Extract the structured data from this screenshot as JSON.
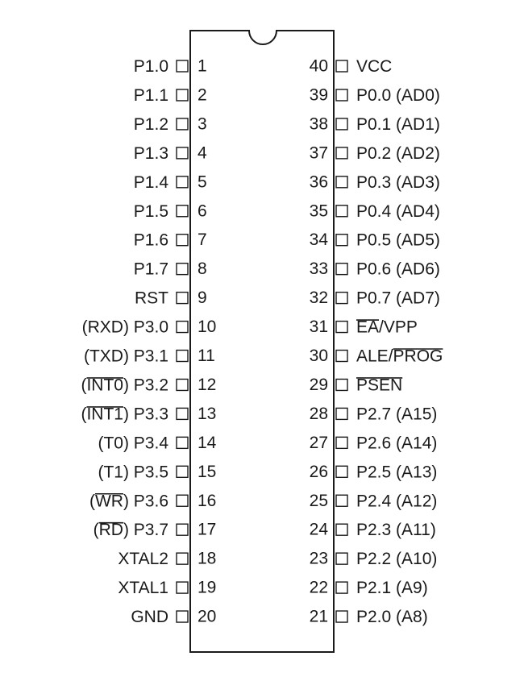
{
  "left_pins": [
    {
      "num": "1",
      "segments": [
        {
          "t": "P1.0",
          "o": false
        }
      ]
    },
    {
      "num": "2",
      "segments": [
        {
          "t": "P1.1",
          "o": false
        }
      ]
    },
    {
      "num": "3",
      "segments": [
        {
          "t": "P1.2",
          "o": false
        }
      ]
    },
    {
      "num": "4",
      "segments": [
        {
          "t": "P1.3",
          "o": false
        }
      ]
    },
    {
      "num": "5",
      "segments": [
        {
          "t": "P1.4",
          "o": false
        }
      ]
    },
    {
      "num": "6",
      "segments": [
        {
          "t": "P1.5",
          "o": false
        }
      ]
    },
    {
      "num": "7",
      "segments": [
        {
          "t": "P1.6",
          "o": false
        }
      ]
    },
    {
      "num": "8",
      "segments": [
        {
          "t": "P1.7",
          "o": false
        }
      ]
    },
    {
      "num": "9",
      "segments": [
        {
          "t": "RST",
          "o": false
        }
      ]
    },
    {
      "num": "10",
      "segments": [
        {
          "t": "(RXD) P3.0",
          "o": false
        }
      ]
    },
    {
      "num": "11",
      "segments": [
        {
          "t": "(TXD) P3.1",
          "o": false
        }
      ]
    },
    {
      "num": "12",
      "segments": [
        {
          "t": "(",
          "o": false
        },
        {
          "t": "INT0",
          "o": true
        },
        {
          "t": ") P3.2",
          "o": false
        }
      ]
    },
    {
      "num": "13",
      "segments": [
        {
          "t": "(",
          "o": false
        },
        {
          "t": "INT1",
          "o": true
        },
        {
          "t": ") P3.3",
          "o": false
        }
      ]
    },
    {
      "num": "14",
      "segments": [
        {
          "t": "(T0) P3.4",
          "o": false
        }
      ]
    },
    {
      "num": "15",
      "segments": [
        {
          "t": "(T1) P3.5",
          "o": false
        }
      ]
    },
    {
      "num": "16",
      "segments": [
        {
          "t": "(",
          "o": false
        },
        {
          "t": "WR",
          "o": true
        },
        {
          "t": ") P3.6",
          "o": false
        }
      ]
    },
    {
      "num": "17",
      "segments": [
        {
          "t": "(",
          "o": false
        },
        {
          "t": "RD",
          "o": true
        },
        {
          "t": ") P3.7",
          "o": false
        }
      ]
    },
    {
      "num": "18",
      "segments": [
        {
          "t": "XTAL2",
          "o": false
        }
      ]
    },
    {
      "num": "19",
      "segments": [
        {
          "t": "XTAL1",
          "o": false
        }
      ]
    },
    {
      "num": "20",
      "segments": [
        {
          "t": "GND",
          "o": false
        }
      ]
    }
  ],
  "right_pins": [
    {
      "num": "40",
      "segments": [
        {
          "t": "VCC",
          "o": false
        }
      ]
    },
    {
      "num": "39",
      "segments": [
        {
          "t": "P0.0 (AD0)",
          "o": false
        }
      ]
    },
    {
      "num": "38",
      "segments": [
        {
          "t": "P0.1 (AD1)",
          "o": false
        }
      ]
    },
    {
      "num": "37",
      "segments": [
        {
          "t": "P0.2 (AD2)",
          "o": false
        }
      ]
    },
    {
      "num": "36",
      "segments": [
        {
          "t": "P0.3 (AD3)",
          "o": false
        }
      ]
    },
    {
      "num": "35",
      "segments": [
        {
          "t": "P0.4 (AD4)",
          "o": false
        }
      ]
    },
    {
      "num": "34",
      "segments": [
        {
          "t": "P0.5 (AD5)",
          "o": false
        }
      ]
    },
    {
      "num": "33",
      "segments": [
        {
          "t": "P0.6 (AD6)",
          "o": false
        }
      ]
    },
    {
      "num": "32",
      "segments": [
        {
          "t": "P0.7 (AD7)",
          "o": false
        }
      ]
    },
    {
      "num": "31",
      "segments": [
        {
          "t": "EA",
          "o": true
        },
        {
          "t": "/VPP",
          "o": false
        }
      ]
    },
    {
      "num": "30",
      "segments": [
        {
          "t": "ALE/",
          "o": false
        },
        {
          "t": "PROG",
          "o": true
        }
      ]
    },
    {
      "num": "29",
      "segments": [
        {
          "t": "PSEN",
          "o": true
        }
      ]
    },
    {
      "num": "28",
      "segments": [
        {
          "t": "P2.7 (A15)",
          "o": false
        }
      ]
    },
    {
      "num": "27",
      "segments": [
        {
          "t": "P2.6 (A14)",
          "o": false
        }
      ]
    },
    {
      "num": "26",
      "segments": [
        {
          "t": "P2.5 (A13)",
          "o": false
        }
      ]
    },
    {
      "num": "25",
      "segments": [
        {
          "t": "P2.4 (A12)",
          "o": false
        }
      ]
    },
    {
      "num": "24",
      "segments": [
        {
          "t": "P2.3 (A11)",
          "o": false
        }
      ]
    },
    {
      "num": "23",
      "segments": [
        {
          "t": "P2.2 (A10)",
          "o": false
        }
      ]
    },
    {
      "num": "22",
      "segments": [
        {
          "t": "P2.1 (A9)",
          "o": false
        }
      ]
    },
    {
      "num": "21",
      "segments": [
        {
          "t": "P2.0 (A8)",
          "o": false
        }
      ]
    }
  ]
}
